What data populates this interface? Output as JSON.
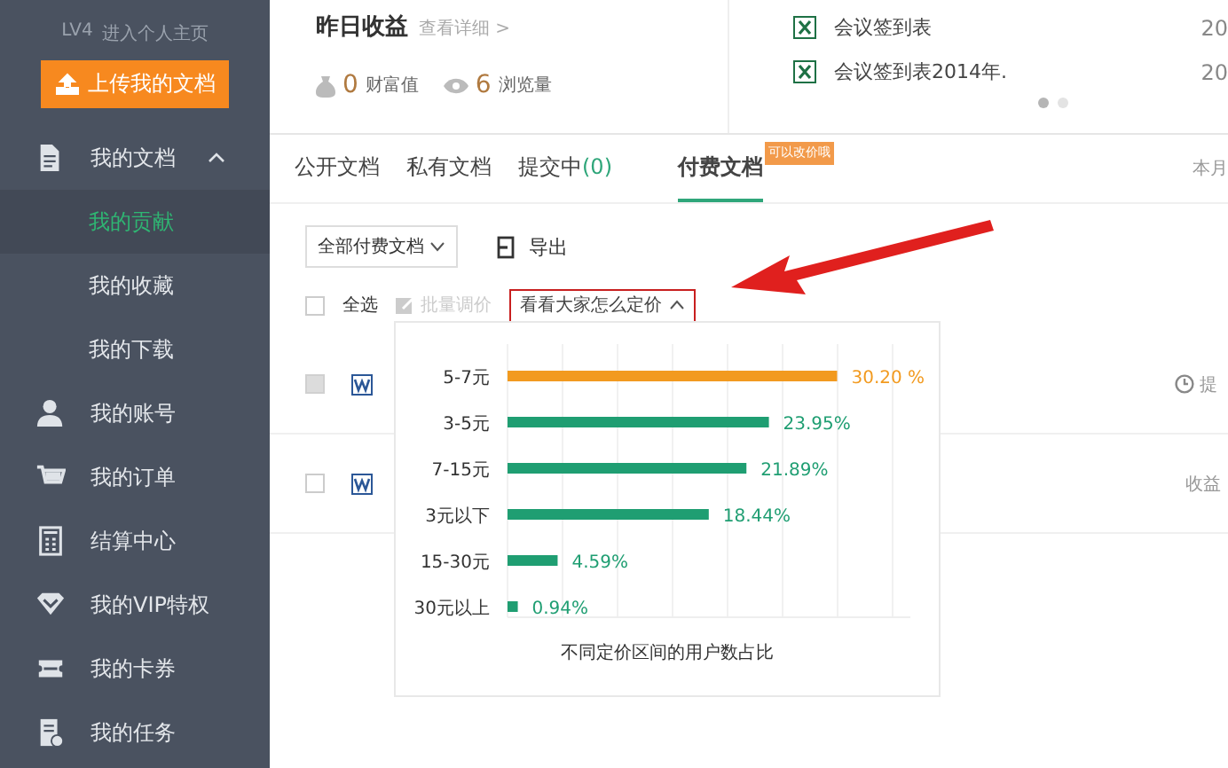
{
  "sidebar": {
    "level_link": {
      "level": "LV4",
      "text": "进入个人主页"
    },
    "upload_button": "上传我的文档",
    "items": [
      {
        "label": "我的文档",
        "expanded": true,
        "children": [
          {
            "label": "我的贡献",
            "selected": true
          },
          {
            "label": "我的收藏",
            "selected": false
          },
          {
            "label": "我的下载",
            "selected": false
          }
        ]
      },
      {
        "label": "我的账号"
      },
      {
        "label": "我的订单"
      },
      {
        "label": "结算中心"
      },
      {
        "label": "我的VIP特权"
      },
      {
        "label": "我的卡券"
      },
      {
        "label": "我的任务"
      }
    ]
  },
  "earnings": {
    "title": "昨日收益",
    "details_link": "查看详细 >",
    "stats": [
      {
        "value": "0",
        "label": "财富值"
      },
      {
        "value": "6",
        "label": "浏览量"
      }
    ]
  },
  "recent_files": {
    "items": [
      {
        "name": "会议签到表",
        "date": "20"
      },
      {
        "name": "会议签到表2014年.",
        "date": "20"
      }
    ],
    "dots": [
      {
        "selected": true
      },
      {
        "selected": false
      }
    ]
  },
  "tabs": [
    {
      "label": "公开文档",
      "selected": false
    },
    {
      "label": "私有文档",
      "selected": false
    },
    {
      "label": "提交中",
      "count": "(0)",
      "selected": false
    },
    {
      "label": "付费文档",
      "badge": "可以改价哦",
      "selected": true
    }
  ],
  "tabs_right": "本月",
  "filter": {
    "dropdown": "全部付费文档",
    "export_button": "导出"
  },
  "actions": {
    "select_all": {
      "label": "全选",
      "checked": false
    },
    "batch_button": {
      "label": "批量调价",
      "disabled": true
    },
    "pricing_button": "看看大家怎么定价"
  },
  "documents": [
    {
      "checked": false,
      "disabled": true,
      "status": {
        "kind": "clock",
        "text": "提"
      }
    },
    {
      "checked": false,
      "disabled": false,
      "status": {
        "kind": "text",
        "text": "收益"
      }
    }
  ],
  "pricing_popup": {
    "chart_data": {
      "type": "bar",
      "orientation": "horizontal",
      "title": "不同定价区间的用户数占比",
      "categories": [
        "5-7元",
        "3-5元",
        "7-15元",
        "3元以下",
        "15-30元",
        "30元以上"
      ],
      "stacked": true,
      "series": [
        {
          "color": "#f29a1f",
          "values": [
            30.2,
            null,
            null,
            null,
            null,
            null
          ],
          "value_labels": [
            "30.20 %",
            null,
            null,
            null,
            null,
            null
          ]
        },
        {
          "color": "#1f9e72",
          "values": [
            null,
            23.95,
            21.89,
            18.44,
            4.59,
            0.94
          ],
          "value_labels": [
            null,
            "23.95%",
            "21.89%",
            "18.44%",
            "4.59%",
            "0.94%"
          ]
        }
      ]
    }
  }
}
